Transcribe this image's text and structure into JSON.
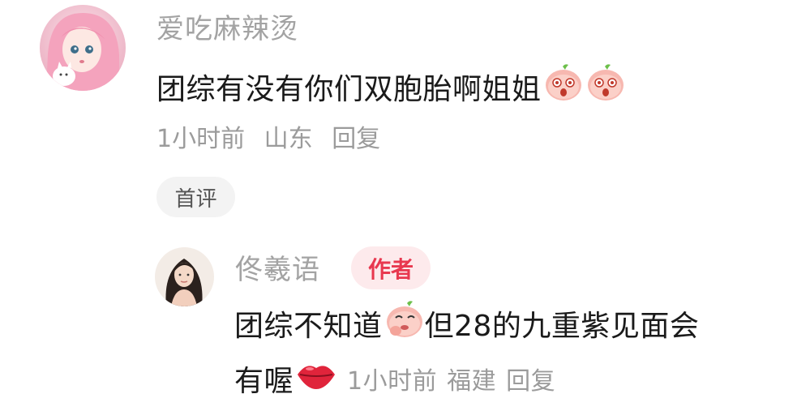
{
  "comment": {
    "username": "爱吃麻辣烫",
    "text": "团综有没有你们双胞胎啊姐姐",
    "emojis": [
      "surprised-peach-emoji",
      "surprised-peach-emoji"
    ],
    "time": "1小时前",
    "location": "山东",
    "reply_label": "回复",
    "first_tag": "首评"
  },
  "reply": {
    "username": "佟羲语",
    "badge": "作者",
    "text_part1": "团综不知道",
    "text_part2": "但28的九重紫见面会",
    "text_part3": "有喔",
    "emojis": [
      "thinking-peach-emoji",
      "lips-emoji"
    ],
    "time": "1小时前",
    "location": "福建",
    "reply_label": "回复"
  }
}
